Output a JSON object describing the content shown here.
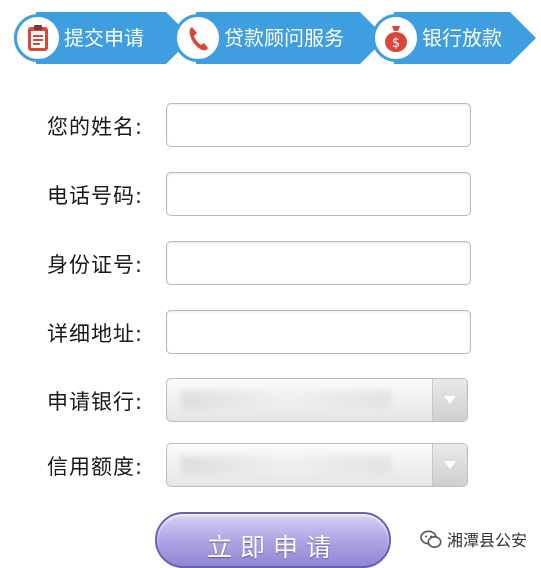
{
  "steps": [
    {
      "label": "提交申请",
      "icon": "clipboard-icon"
    },
    {
      "label": "贷款顾问服务",
      "icon": "phone-icon"
    },
    {
      "label": "银行放款",
      "icon": "money-bag-icon"
    }
  ],
  "form": {
    "name_label": "您的姓名:",
    "phone_label": "电话号码:",
    "id_label": "身份证号:",
    "address_label": "详细地址:",
    "bank_label": "申请银行:",
    "limit_label": "信用额度:"
  },
  "submit_label": "立即申请",
  "watermark": {
    "text": "湘潭县公安",
    "icon": "wechat-icon"
  },
  "colors": {
    "step_blue": "#3f9ee0",
    "submit_purple": "#9186d4",
    "clipboard_red": "#d9463b",
    "bag_red": "#d9463b"
  }
}
